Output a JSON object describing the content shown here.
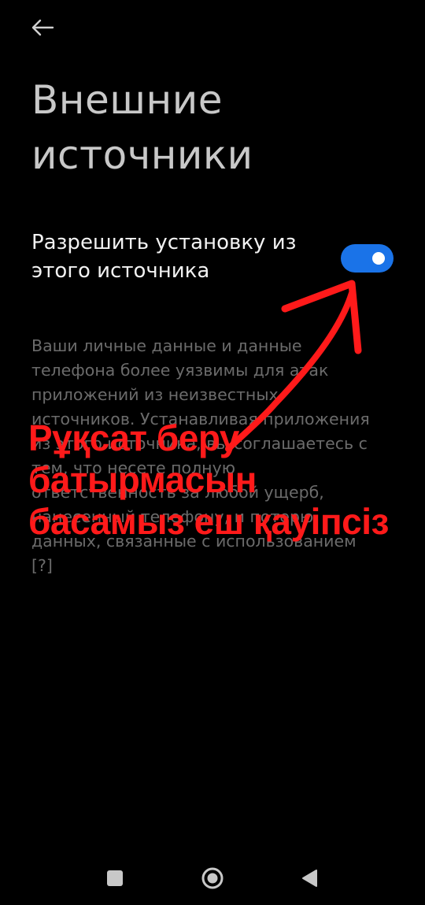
{
  "header": {
    "back_icon": "arrow-left-icon",
    "title": "Внешние источники"
  },
  "setting": {
    "label": "Разрешить установку из этого источника",
    "enabled": true,
    "accent_color": "#1a73e8"
  },
  "warning": {
    "text": "Ваши личные данные и данные телефона более уязвимы для атак приложений из неизвестных источников. Устанавливая приложения из этого источника, вы соглашаетесь с тем, что несете полную ответственность за любой ущерб, нанесенный телефону, и потерю данных, связанные с использованием [?]"
  },
  "annotation": {
    "text": "Рұқсат беру батырмасын басамыз еш қауіпсіз",
    "color": "#ff1a1a"
  },
  "navbar": {
    "recents_icon": "square-icon",
    "home_icon": "circle-icon",
    "back_icon": "triangle-back-icon"
  }
}
